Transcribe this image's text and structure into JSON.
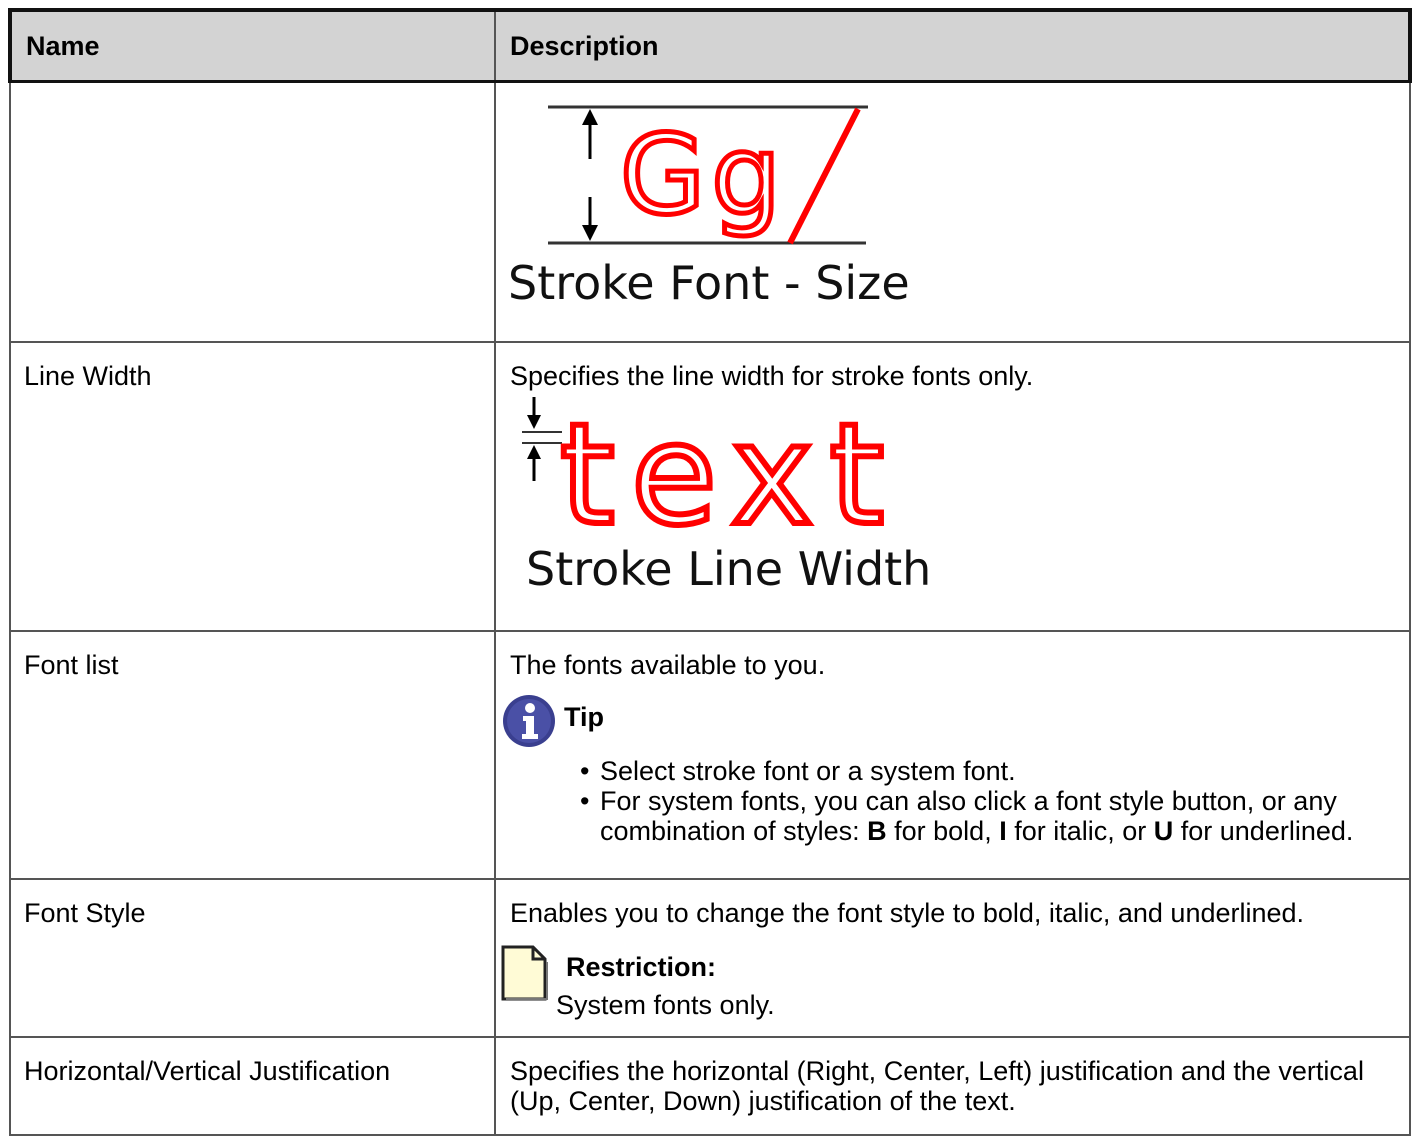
{
  "table": {
    "headers": {
      "name": "Name",
      "description": "Description"
    },
    "rows": {
      "stroke_size": {
        "name": "",
        "figure_caption": "Stroke Font - Size",
        "figure_glyphs": "Gg"
      },
      "line_width": {
        "name": "Line Width",
        "description": "Specifies the line width for stroke fonts only.",
        "figure_text": "text",
        "figure_caption": "Stroke Line Width"
      },
      "font_list": {
        "name": "Font list",
        "description": "The fonts available to you.",
        "tip_label": "Tip",
        "tips": {
          "item1": "Select stroke font or a system font.",
          "item2_prefix": "For system fonts, you can also click a font style button, or any combination of styles: ",
          "bold_key": "B",
          "bold_text": " for bold, ",
          "italic_key": "I",
          "italic_text": " for italic, or ",
          "underline_key": "U",
          "underline_text": " for underlined."
        }
      },
      "font_style": {
        "name": "Font Style",
        "description": "Enables you to change the font style to bold, italic, and underlined.",
        "restriction_label": "Restriction:",
        "restriction_text": "System fonts only."
      },
      "justification": {
        "name": "Horizontal/Vertical Justification",
        "description": "Specifies the horizontal (Right, Center, Left) justification and the vertical (Up, Center, Down) justification of the text."
      }
    }
  },
  "colors": {
    "header_bg": "#d3d3d3",
    "stroke_red": "#ff0000",
    "tip_icon": "#3a3f8f",
    "note_icon": "#fffbd6"
  },
  "icons": {
    "tip": "info-icon",
    "restriction": "note-icon"
  }
}
